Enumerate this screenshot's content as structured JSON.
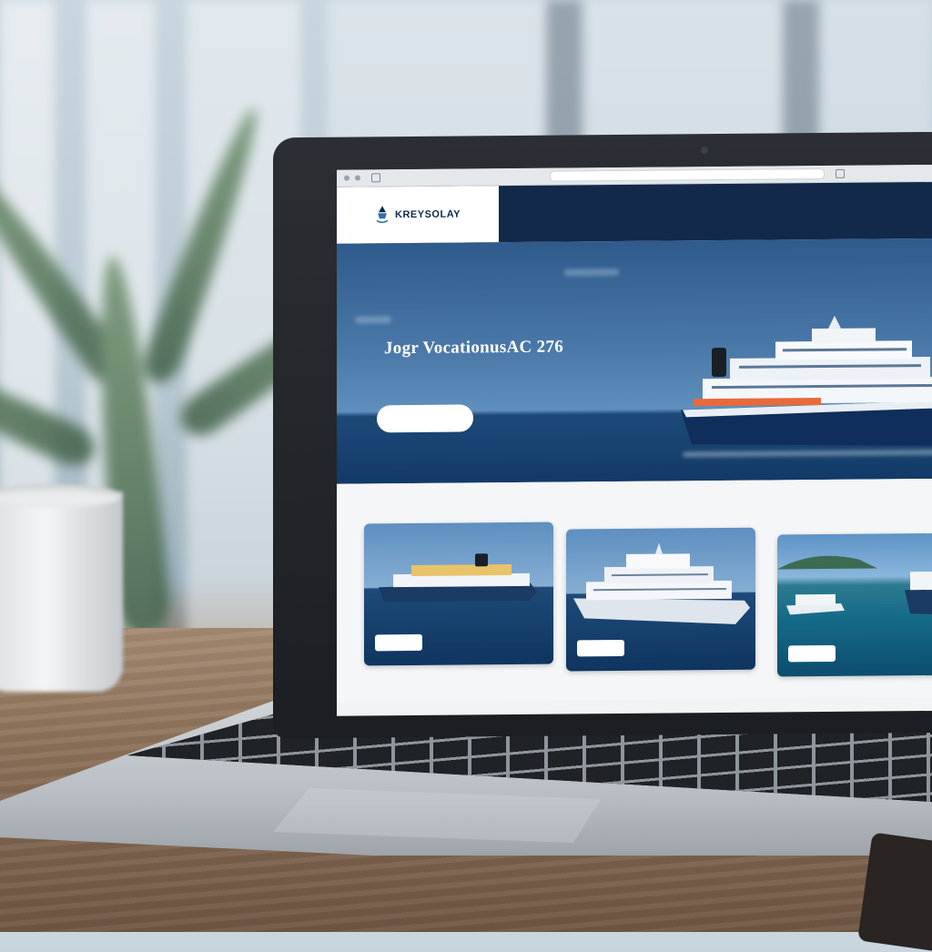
{
  "site": {
    "logo_title": "KREYSOLAY",
    "logo_subtitle": "",
    "nav": [
      "",
      "",
      "",
      "",
      "",
      "",
      ""
    ]
  },
  "hero": {
    "title": "Jogr VocationusAC 276",
    "body": "",
    "button_label": ""
  },
  "cards": [
    {
      "caption": "",
      "button_label": ""
    },
    {
      "caption": "",
      "button_label": ""
    },
    {
      "caption": "",
      "button_label": ""
    }
  ],
  "colors": {
    "brand_navy": "#13294a",
    "hero_blue": "#2f5a8c",
    "button_white": "#ffffff"
  },
  "icons": [
    "cruise-logo-icon",
    "browser-dot-icon"
  ]
}
